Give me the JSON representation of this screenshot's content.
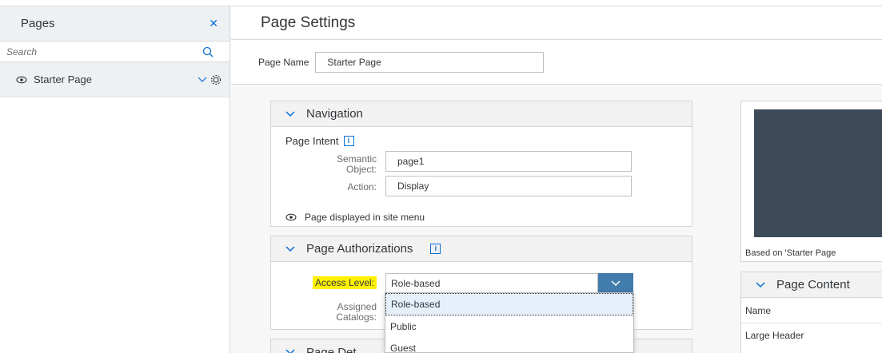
{
  "sidebar": {
    "title": "Pages",
    "close_glyph": "✕",
    "search": {
      "placeholder": "Search"
    },
    "items": [
      {
        "label": "Starter Page"
      }
    ]
  },
  "main": {
    "title": "Page Settings",
    "page_name": {
      "label": "Page Name",
      "value": "Starter Page"
    }
  },
  "navigation": {
    "title": "Navigation",
    "intent_label": "Page Intent",
    "semantic_label": "Semantic\nObject:",
    "semantic_value": "page1",
    "action_label": "Action:",
    "action_value": "Display",
    "menu_note": "Page displayed in site menu"
  },
  "authorizations": {
    "title": "Page Authorizations",
    "access_label": "Access Level:",
    "access_value": "Role-based",
    "catalogs_label": "Assigned\nCatalogs:",
    "options": [
      "Role-based",
      "Public",
      "Guest"
    ]
  },
  "details": {
    "title": "Page Det"
  },
  "preview": {
    "caption": "Based on 'Starter Page"
  },
  "content": {
    "title": "Page Content",
    "column": "Name",
    "rows": [
      "Large Header"
    ]
  },
  "colors": {
    "accent": "#0a6ed1",
    "button": "#427cac",
    "preview_bg": "#3d4b59",
    "highlight": "#fff200"
  },
  "icons": [
    "close-icon",
    "search-icon",
    "eye-icon",
    "chevron-down-icon",
    "gear-icon",
    "info-icon"
  ]
}
